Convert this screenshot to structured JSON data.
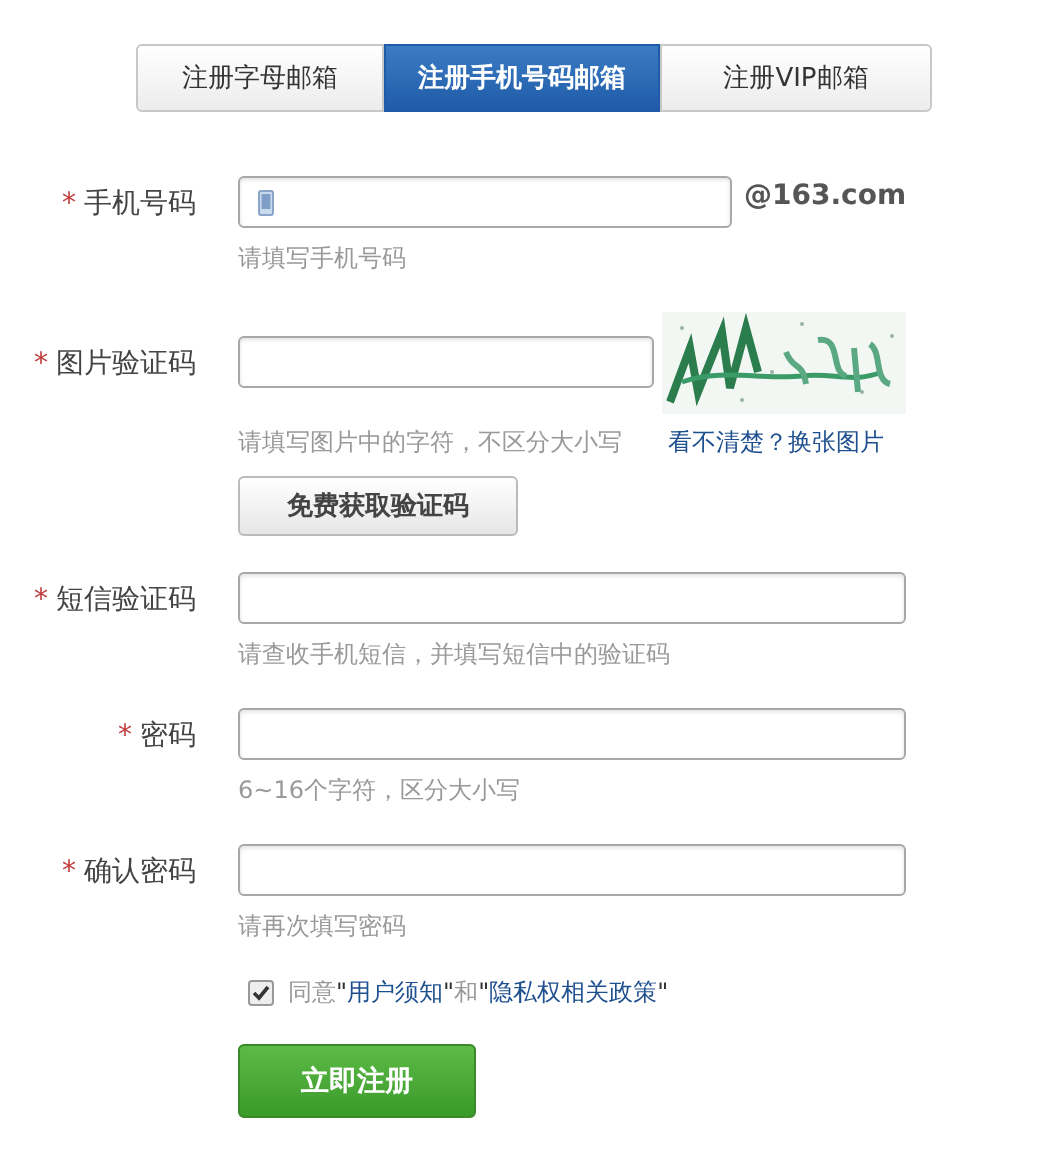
{
  "tabs": [
    {
      "label": "注册字母邮箱",
      "selected": false
    },
    {
      "label": "注册手机号码邮箱",
      "selected": true
    },
    {
      "label": "注册VIP邮箱",
      "selected": false
    }
  ],
  "fields": [
    {
      "kind": "phone",
      "label": "手机号码",
      "required_mark": "*",
      "suffix": "@163.com",
      "hint": "请填写手机号码"
    },
    {
      "kind": "captcha",
      "label": "图片验证码",
      "required_mark": "*",
      "hint": "请填写图片中的字符，不区分大小写",
      "refresh_link": "看不清楚？换张图片",
      "button": "免费获取验证码"
    },
    {
      "kind": "text",
      "label": "短信验证码",
      "required_mark": "*",
      "hint": "请查收手机短信，并填写短信中的验证码"
    },
    {
      "kind": "text",
      "label": "密码",
      "required_mark": "*",
      "hint": "6~16个字符，区分大小写"
    },
    {
      "kind": "text",
      "label": "确认密码",
      "required_mark": "*",
      "hint": "请再次填写密码"
    }
  ],
  "agreement": {
    "checked": true,
    "prefix": "同意",
    "quote_open_1": "\"",
    "link_1": "用户须知",
    "quote_close_1": "\"",
    "middle": "和",
    "quote_open_2": "\"",
    "link_2": "隐私权相关政策",
    "quote_close_2": "\""
  },
  "submit": "立即注册"
}
